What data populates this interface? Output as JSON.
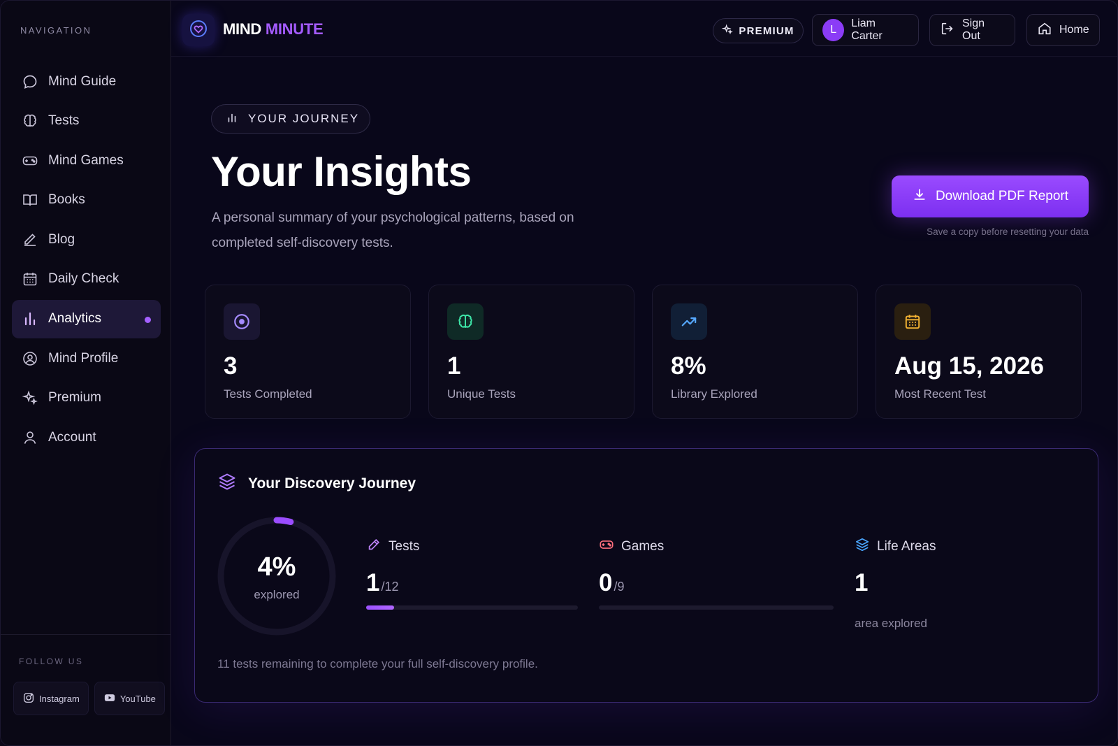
{
  "sidebar": {
    "heading": "NAVIGATION",
    "items": [
      {
        "label": "Mind Guide",
        "icon": "chat-bubble-icon"
      },
      {
        "label": "Tests",
        "icon": "brain-icon"
      },
      {
        "label": "Mind Games",
        "icon": "gamepad-icon"
      },
      {
        "label": "Books",
        "icon": "book-icon"
      },
      {
        "label": "Blog",
        "icon": "pen-icon"
      },
      {
        "label": "Daily Check",
        "icon": "calendar-icon"
      },
      {
        "label": "Analytics",
        "icon": "bar-chart-icon",
        "active": true
      },
      {
        "label": "Mind Profile",
        "icon": "user-circle-icon"
      },
      {
        "label": "Premium",
        "icon": "sparkles-icon"
      },
      {
        "label": "Account",
        "icon": "user-icon"
      }
    ],
    "follow_heading": "FOLLOW US",
    "social": [
      {
        "label": "Instagram",
        "icon": "instagram-icon"
      },
      {
        "label": "YouTube",
        "icon": "youtube-icon"
      }
    ]
  },
  "topbar": {
    "logo_part1": "MIND",
    "logo_part2": "MINUTE",
    "premium_label": "PREMIUM",
    "user_initial": "L",
    "user_name": "Liam Carter",
    "sign_out_label": "Sign Out",
    "home_label": "Home"
  },
  "header": {
    "pill_label": "YOUR JOURNEY",
    "title": "Your Insights",
    "subtitle": "A personal summary of your psychological patterns, based on completed self-discovery tests.",
    "download_label": "Download PDF Report",
    "download_note": "Save a copy before resetting your data"
  },
  "stats": [
    {
      "value": "3",
      "label": "Tests Completed",
      "icon": "target-icon",
      "color": "#a68cff"
    },
    {
      "value": "1",
      "label": "Unique Tests",
      "icon": "brain-icon",
      "color": "#3ee6a8"
    },
    {
      "value": "8%",
      "label": "Library Explored",
      "icon": "trend-up-icon",
      "color": "#56a8ff"
    },
    {
      "value": "Aug 15, 2026",
      "label": "Most Recent Test",
      "icon": "calendar-icon",
      "color": "#f2b233"
    }
  ],
  "discovery": {
    "title": "Your Discovery Journey",
    "progress_value": "4%",
    "progress_fraction": 0.04,
    "progress_label": "explored",
    "metrics": {
      "tests": {
        "label": "Tests",
        "value": "1",
        "of": "/12",
        "fraction": 0.133
      },
      "games": {
        "label": "Games",
        "value": "0",
        "of": "/9",
        "fraction": 0
      },
      "areas": {
        "label": "Life Areas",
        "value": "1",
        "note": "area explored"
      }
    },
    "footer": "11 tests remaining to complete your full self-discovery profile."
  },
  "colors": {
    "accent": "#9b4dff",
    "background": "#09071a",
    "card": "#0c0a1a"
  }
}
